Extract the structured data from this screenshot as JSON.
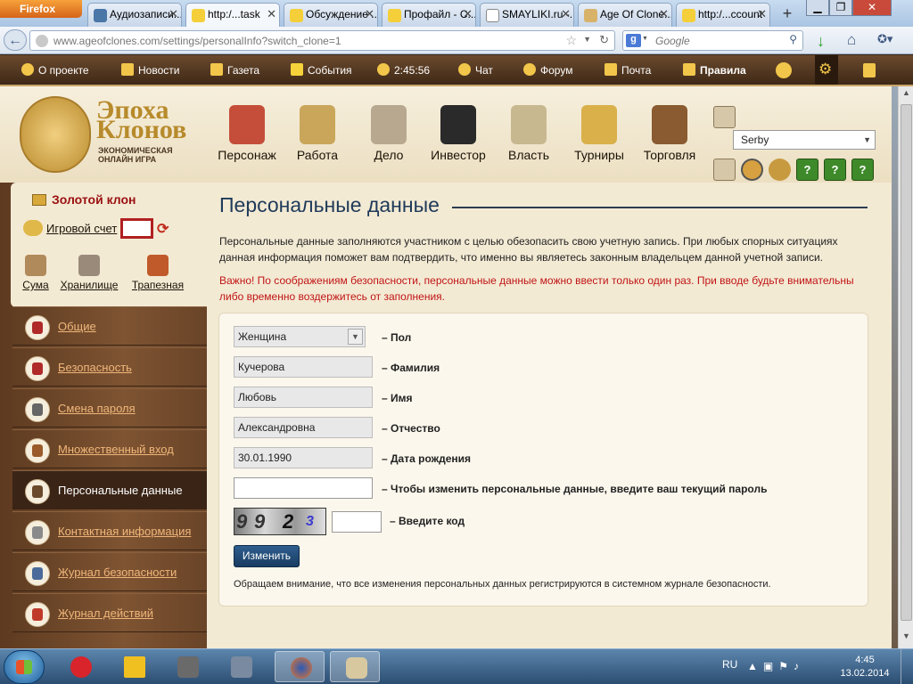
{
  "browser": {
    "menu_button": "Firefox",
    "tabs": [
      {
        "label": "Аудиозаписи..."
      },
      {
        "label": "http:/...task"
      },
      {
        "label": "Обсуждение ..."
      },
      {
        "label": "Профайл - С..."
      },
      {
        "label": "SMAYLIKI.ru -..."
      },
      {
        "label": "Age Of Clone..."
      },
      {
        "label": "http:/...ccount"
      }
    ],
    "new_tab": "+",
    "url_domain": "www.ageofclones.com",
    "url_path": "/settings/personalInfo?switch_clone=1",
    "search_placeholder": "Google",
    "search_engine": "g"
  },
  "site_nav": {
    "items": [
      {
        "label": "О проекте"
      },
      {
        "label": "Новости"
      },
      {
        "label": "Газета"
      },
      {
        "label": "События"
      },
      {
        "label": "2:45:56"
      },
      {
        "label": "Чат"
      },
      {
        "label": "Форум"
      },
      {
        "label": "Почта"
      },
      {
        "label": "Правила"
      }
    ]
  },
  "logo": {
    "line1": "Эпоха",
    "line2": "Клонов",
    "tagline": "ЭКОНОМИЧЕСКАЯ ОНЛАЙН ИГРА"
  },
  "header_nav": [
    {
      "label": "Персонаж"
    },
    {
      "label": "Работа"
    },
    {
      "label": "Дело"
    },
    {
      "label": "Инвестор"
    },
    {
      "label": "Власть"
    },
    {
      "label": "Турниры"
    },
    {
      "label": "Торговля"
    }
  ],
  "server_select": {
    "value": "Serby"
  },
  "help_buttons": [
    "?",
    "?",
    "?"
  ],
  "sidebar": {
    "gold_title": "Золотой клон",
    "account_label": "Игровой счет",
    "icons": [
      {
        "label": "Сума"
      },
      {
        "label": "Хранилище"
      },
      {
        "label": "Трапезная"
      }
    ],
    "menu": [
      {
        "label": "Общие"
      },
      {
        "label": "Безопасность"
      },
      {
        "label": "Смена пароля"
      },
      {
        "label": "Множественный вход"
      },
      {
        "label": "Персональные данные"
      },
      {
        "label": "Контактная информация"
      },
      {
        "label": "Журнал безопасности"
      },
      {
        "label": "Журнал действий"
      }
    ]
  },
  "main": {
    "title": "Персональные данные",
    "intro": "Персональные данные заполняются участником с целью обезопасить свою учетную запись. При любых спорных ситуациях данная информация поможет вам подтвердить, что именно вы являетесь законным владельцем данной учетной записи.",
    "warning": "Важно! По соображениям безопасности, персональные данные можно ввести только один раз. При вводе будьте внимательны либо временно воздержитесь от заполнения.",
    "form": {
      "gender": {
        "value": "Женщина",
        "label": "– Пол"
      },
      "surname": {
        "value": "Кучерова",
        "label": "– Фамилия"
      },
      "name": {
        "value": "Любовь",
        "label": "– Имя"
      },
      "patronymic": {
        "value": "Александровна",
        "label": "– Отчество"
      },
      "birthdate": {
        "value": "30.01.1990",
        "label": "– Дата рождения"
      },
      "password": {
        "value": "",
        "label": "– Чтобы изменить персональные данные, введите ваш текущий пароль"
      },
      "captcha_text": [
        "9",
        "9",
        "2",
        "3"
      ],
      "code": {
        "value": "",
        "label": "– Введите код"
      },
      "submit_label": "Изменить"
    },
    "note": "Обращаем внимание, что все изменения персональных данных регистрируются в системном журнале безопасности."
  },
  "taskbar": {
    "lang": "RU",
    "time": "4:45",
    "date": "13.02.2014"
  }
}
